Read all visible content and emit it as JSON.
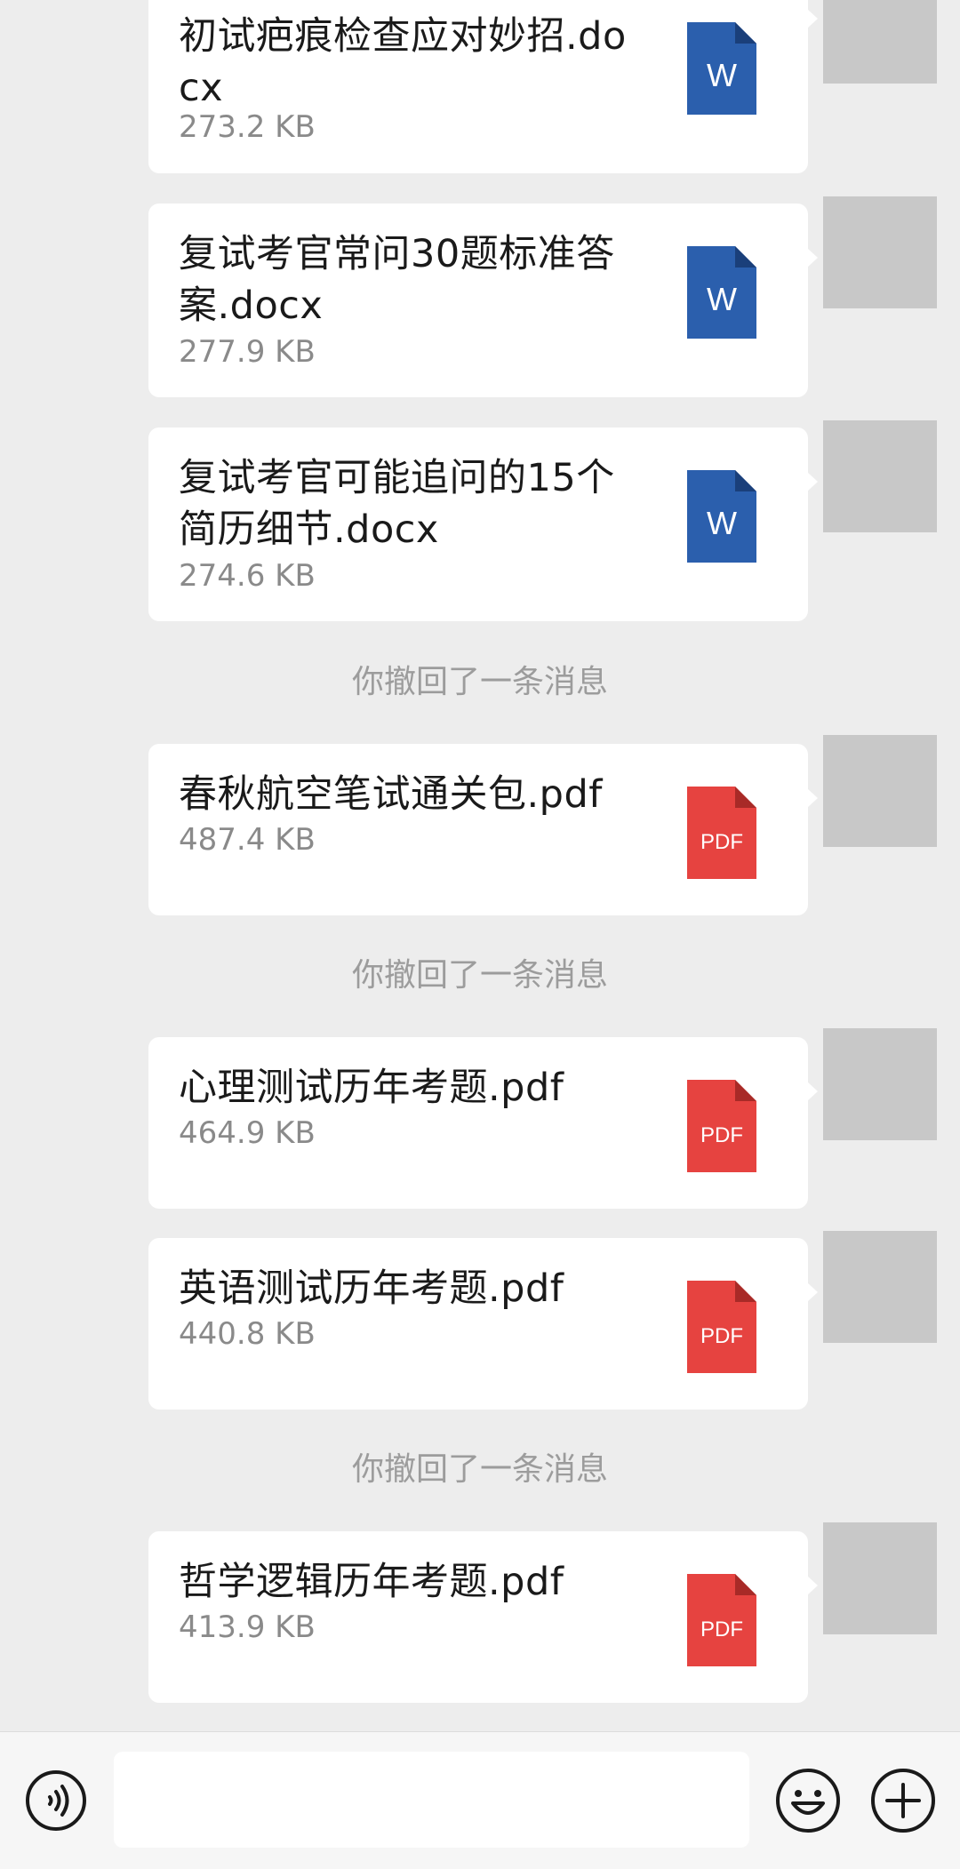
{
  "messages": [
    {
      "type": "file",
      "name": "初试疤痕检查应对妙招.docx",
      "size": "273.2 KB",
      "icon": "word-doc-icon"
    },
    {
      "type": "file",
      "name": "复试考官常问30题标准答案.docx",
      "size": "277.9 KB",
      "icon": "word-doc-icon"
    },
    {
      "type": "file",
      "name": "复试考官可能追问的15个简历细节.docx",
      "size": "274.6 KB",
      "icon": "word-doc-icon"
    },
    {
      "type": "recall",
      "text": "你撤回了一条消息"
    },
    {
      "type": "file",
      "name": "春秋航空笔试通关包.pdf",
      "size": "487.4 KB",
      "icon": "pdf-icon"
    },
    {
      "type": "recall",
      "text": "你撤回了一条消息"
    },
    {
      "type": "file",
      "name": "心理测试历年考题.pdf",
      "size": "464.9 KB",
      "icon": "pdf-icon"
    },
    {
      "type": "file",
      "name": "英语测试历年考题.pdf",
      "size": "440.8 KB",
      "icon": "pdf-icon"
    },
    {
      "type": "recall",
      "text": "你撤回了一条消息"
    },
    {
      "type": "file",
      "name": "哲学逻辑历年考题.pdf",
      "size": "413.9 KB",
      "icon": "pdf-icon"
    }
  ],
  "file_icons": {
    "word_label": "W",
    "word_color": "#2b5fad",
    "pdf_label": "PDF",
    "pdf_color": "#e64340"
  },
  "input_bar": {
    "value": "",
    "voice_icon": "voice-icon",
    "emoji_icon": "emoji-icon",
    "plus_icon": "plus-icon"
  }
}
